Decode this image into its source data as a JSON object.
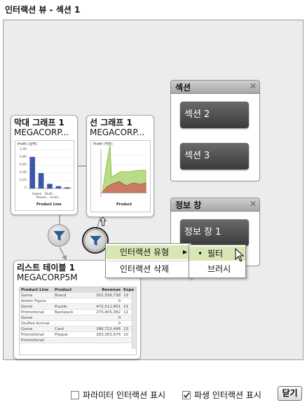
{
  "window": {
    "title": "인터랙션 뷰 - 섹션 1"
  },
  "cards": {
    "bar": {
      "title": "막대 그래프 1",
      "subtitle": "MEGACORP...",
      "chart_title": "Profit (실적)",
      "yticks": [
        "1,00",
        "0,80",
        "0,60",
        "0,40",
        "0,20",
        "0"
      ],
      "xticks": [
        "Game",
        "Stuff...",
        "Promo...",
        "Anim..."
      ],
      "xlabel": "Product Line",
      "values": [
        0.82,
        0.4,
        0.12,
        0.06,
        0.03
      ],
      "ylim": [
        0,
        1
      ]
    },
    "line": {
      "title": "선 그래프 1",
      "subtitle": "MEGACORP...",
      "chart_title": "Profit (적자)",
      "xlabel": "Product"
    },
    "list": {
      "title": "리스트 테이블 1",
      "subtitle": "MEGACORP5M",
      "columns": [
        "Product Line",
        "Product",
        "Revenue",
        "Expe"
      ],
      "rows": [
        [
          "Game",
          "Board",
          "302,556,738",
          "19"
        ],
        [
          "Action Figure",
          "",
          "0",
          ""
        ],
        [
          "Game",
          "Puzzle",
          "472,511,801",
          "11"
        ],
        [
          "Promotional",
          "Backpack",
          "270,405,082",
          "11"
        ],
        [
          "Game",
          ".",
          "0",
          ""
        ],
        [
          "Stuffed Animal",
          ".",
          "0",
          ""
        ],
        [
          "Game",
          "Card",
          "396,722,446",
          "13"
        ],
        [
          "Promotional",
          "Plaque",
          "163,301,674",
          "10"
        ],
        [
          "Promotional",
          ".",
          "",
          ""
        ]
      ]
    }
  },
  "panels": {
    "section": {
      "title": "섹션",
      "close": "✕",
      "buttons": [
        "섹션 2",
        "섹션 3"
      ]
    },
    "info": {
      "title": "정보 창",
      "close": "✕",
      "buttons": [
        "정보 창 1"
      ]
    }
  },
  "context_menu": {
    "items": [
      "인터랙션 유형",
      "인터랙션 삭제"
    ],
    "submenu_arrow": "▶",
    "submenu": {
      "items": [
        "필터",
        "브러시"
      ],
      "selected": "필터",
      "bullet": "•"
    }
  },
  "footer": {
    "param_interaction_label": "파라미터 인터랙션 표시",
    "param_checked": false,
    "derived_interaction_label": "파생 인터랙션 표시",
    "derived_checked": true,
    "close_label": "닫기"
  },
  "colors": {
    "bar": "#3a57a8",
    "line_green": "#78b82a",
    "line_red": "#b04a3b",
    "selected_menu": "#d7e6b3"
  }
}
